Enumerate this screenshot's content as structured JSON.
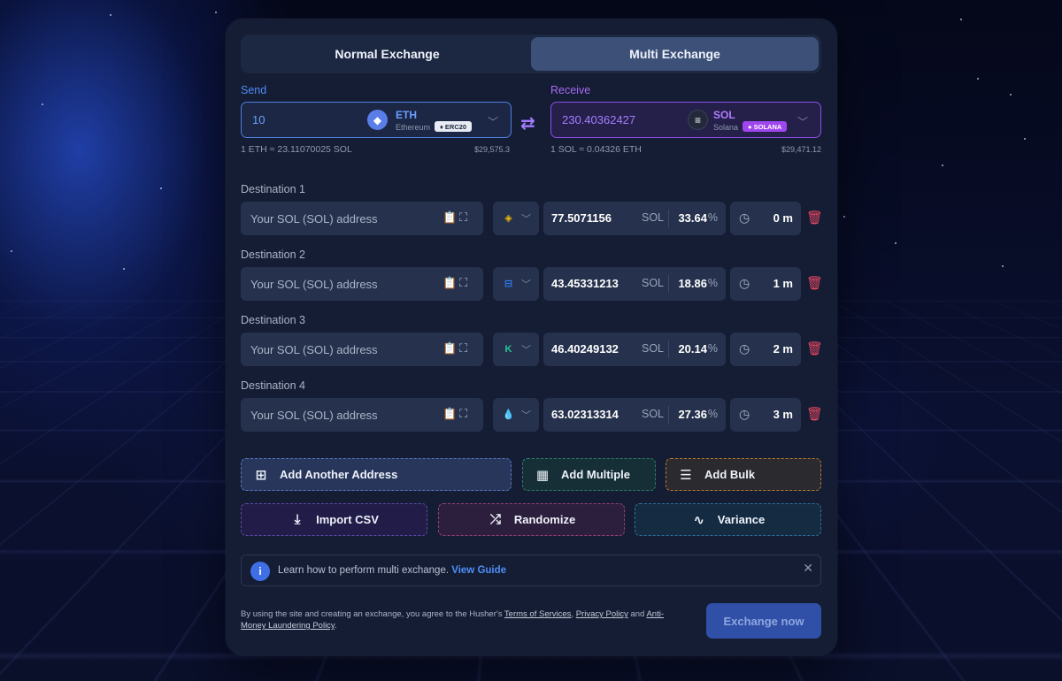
{
  "tabs": [
    {
      "label": "Normal Exchange",
      "active": false
    },
    {
      "label": "Multi Exchange",
      "active": true
    }
  ],
  "send": {
    "label": "Send",
    "amount": "10",
    "symbol": "ETH",
    "network": "Ethereum",
    "badge": "ERC20",
    "rate": "1 ETH ≈ 23.11070025 SOL",
    "usd": "$29,575.3"
  },
  "receive": {
    "label": "Receive",
    "amount": "230.40362427",
    "symbol": "SOL",
    "network": "Solana",
    "badge": "SOLANA",
    "rate": "1 SOL ≈ 0.04326 ETH",
    "usd": "$29,471.12"
  },
  "destinations": [
    {
      "label": "Destination 1",
      "placeholder": "Your SOL (SOL) address",
      "exchange_icon": "binance-icon",
      "amount": "77.5071156",
      "unit": "SOL",
      "percent": "33.64",
      "percent_sign": "%",
      "time": "0 m"
    },
    {
      "label": "Destination 2",
      "placeholder": "Your SOL (SOL) address",
      "exchange_icon": "exchange-link-icon",
      "amount": "43.45331213",
      "unit": "SOL",
      "percent": "18.86",
      "percent_sign": "%",
      "time": "1 m"
    },
    {
      "label": "Destination 3",
      "placeholder": "Your SOL (SOL) address",
      "exchange_icon": "kucoin-icon",
      "amount": "46.40249132",
      "unit": "SOL",
      "percent": "20.14",
      "percent_sign": "%",
      "time": "2 m"
    },
    {
      "label": "Destination 4",
      "placeholder": "Your SOL (SOL) address",
      "exchange_icon": "drop-icon",
      "amount": "63.02313314",
      "unit": "SOL",
      "percent": "27.36",
      "percent_sign": "%",
      "time": "3 m"
    }
  ],
  "actions": {
    "add_another": "Add Another Address",
    "add_multiple": "Add Multiple",
    "add_bulk": "Add Bulk",
    "import_csv": "Import CSV",
    "randomize": "Randomize",
    "variance": "Variance"
  },
  "info": {
    "text": "Learn how to perform multi exchange.",
    "link": "View Guide"
  },
  "terms": {
    "prefix": "By using the site and creating an exchange, you agree to the Husher's",
    "tos": "Terms of Services",
    "privacy": "Privacy Policy",
    "and": "and",
    "aml": "Anti-Money Laundering Policy",
    "suffix": "."
  },
  "exchange_button": "Exchange now",
  "colors": {
    "accent_blue": "#4f8cf5",
    "accent_purple": "#a76bf5",
    "delete_red": "#e64863",
    "panel": "#141d33"
  }
}
